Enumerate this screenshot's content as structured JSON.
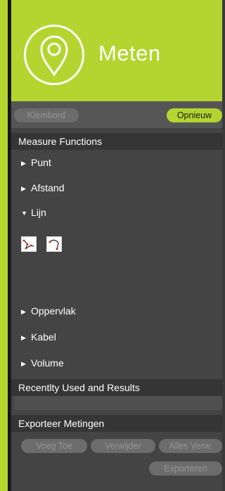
{
  "header": {
    "title": "Meten",
    "logo_icon": "map-pin-icon",
    "color": "#b4d52f"
  },
  "toolbar": {
    "klembord_label": "Klembord",
    "opnieuw_label": "Opnieuw"
  },
  "measure": {
    "heading": "Measure Functions",
    "items": [
      {
        "label": "Punt",
        "expanded": false
      },
      {
        "label": "Afstand",
        "expanded": false
      },
      {
        "label": "Lijn",
        "expanded": true
      },
      {
        "label": "Oppervlak",
        "expanded": false
      },
      {
        "label": "Kabel",
        "expanded": false
      },
      {
        "label": "Volume",
        "expanded": false
      }
    ],
    "lijn_tools": [
      "polyline-tool-icon",
      "arc-tool-icon"
    ]
  },
  "recent": {
    "heading": "Recentlty Used and Results"
  },
  "export": {
    "heading": "Exporteer Metingen",
    "buttons": [
      "Voeg Toe",
      "Verwijder",
      "Alles Verw.",
      "Exporteren"
    ]
  }
}
